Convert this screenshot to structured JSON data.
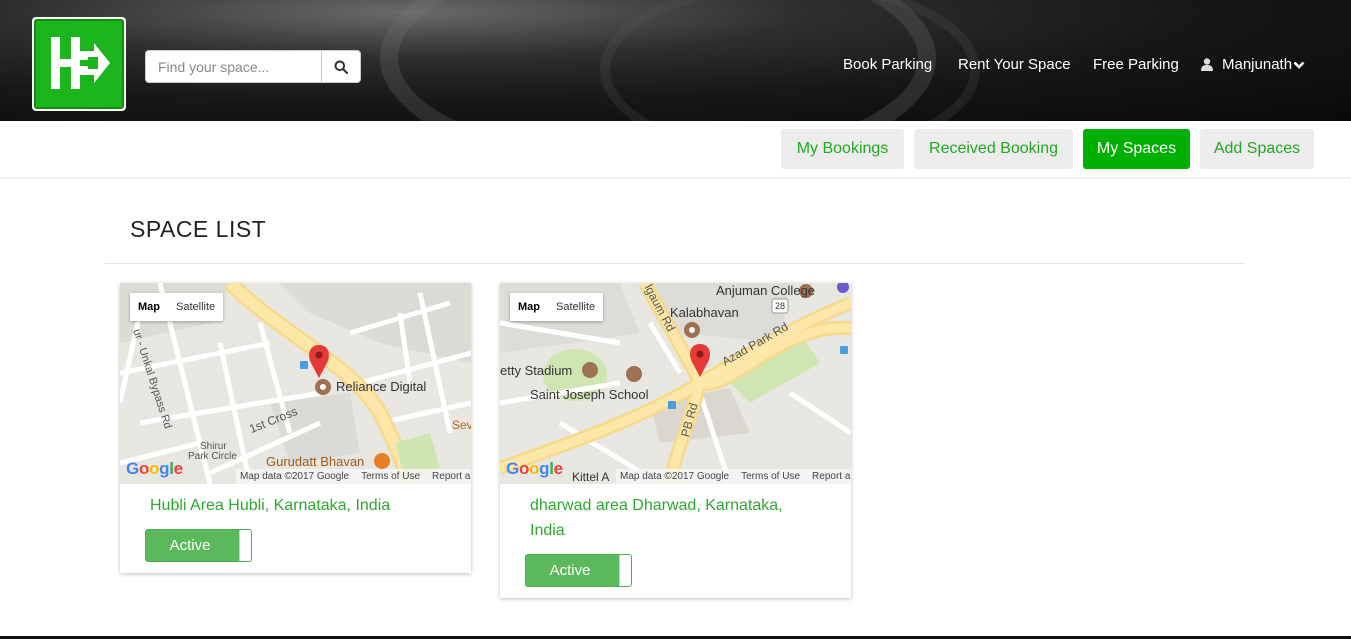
{
  "header": {
    "logo_text": "HP",
    "search": {
      "placeholder": "Find your space...",
      "button_icon": "search-icon"
    },
    "nav": {
      "book_parking": "Book Parking",
      "rent_space": "Rent Your Space",
      "free_parking": "Free Parking",
      "user_name": "Manjunath",
      "user_icon": "user-icon",
      "dropdown_icon": "chevron-down-icon"
    }
  },
  "tabs": [
    {
      "label": "My Bookings",
      "active": false
    },
    {
      "label": "Received Booking",
      "active": false
    },
    {
      "label": "My Spaces",
      "active": true
    },
    {
      "label": "Add Spaces",
      "active": false
    }
  ],
  "page_title": "SPACE LIST",
  "map_common": {
    "map_label": "Map",
    "satellite_label": "Satellite",
    "google": "Google",
    "map_data": "Map data ©2017 Google",
    "terms": "Terms of Use",
    "report": "Report a"
  },
  "spaces": [
    {
      "location": "Hubli Area Hubli, Karnataka, India",
      "status": "Active",
      "map_labels": {
        "road1": "1st Cross",
        "road2": "ur - Unkal Bypass Rd",
        "poi1": "Reliance Digital",
        "poi2": "Gurudatt Bhavan",
        "poi3": "Shirur",
        "poi4": "Park Circle",
        "poi5": "Sev"
      }
    },
    {
      "location": "dharwad area Dharwad, Karnataka, India",
      "status": "Active",
      "map_labels": {
        "poi1": "Anjuman College",
        "poi2": "Kalabhavan",
        "poi3": "etty Stadium",
        "poi4": "Saint Joseph School",
        "poi5": "Kittel A",
        "road1": "Azad Park Rd",
        "road2": "PB Rd",
        "road3": "lgaum Rd",
        "shield": "28"
      }
    }
  ],
  "colors": {
    "brand_green": "#1db51d",
    "tab_active": "#00b000",
    "tab_text": "#22a822",
    "toggle_green": "#5cb85c",
    "location_text": "#2ea82e"
  }
}
